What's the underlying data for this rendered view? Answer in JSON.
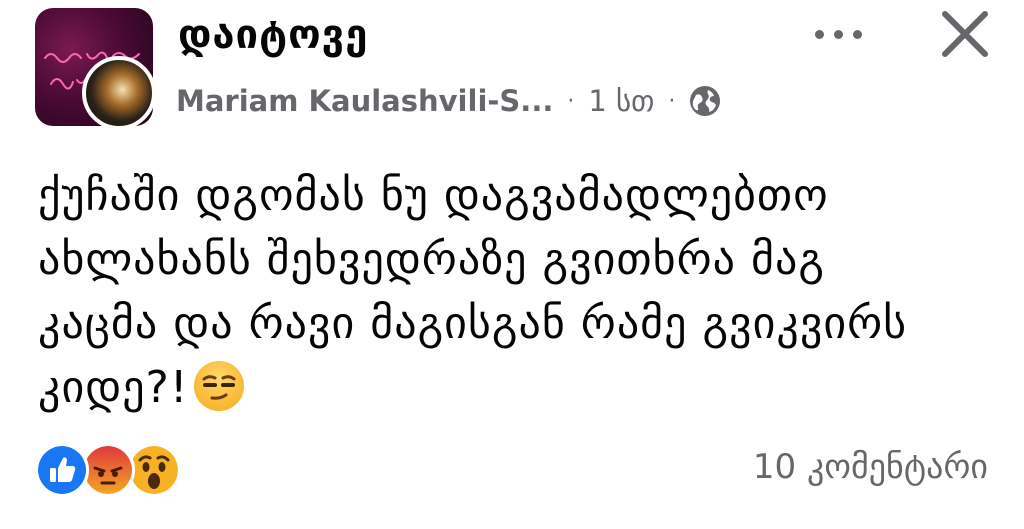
{
  "header": {
    "group_name": "დაიტოვე",
    "author": "Mariam Kaulashvili-S...",
    "separator": "·",
    "time": "1 სთ"
  },
  "post": {
    "text": "ქუჩაში დგომას ნუ დაგვამადლებთო\nახლახანს შეხვედრაზე გვითხრა მაგ\nკაცმა და რავი მაგისგან რამე გვიკვირს\nკიდე?!"
  },
  "footer": {
    "comments": "10 კომენტარი"
  },
  "icons": {
    "audience": "globe-icon",
    "more": "more-icon",
    "close": "close-icon",
    "reactions": [
      "like-icon",
      "angry-icon",
      "wow-icon"
    ],
    "emoji": "smirk-emoji"
  },
  "colors": {
    "text": "#050505",
    "secondary": "#65676b",
    "like": "#1877f2",
    "angry": "#e9710f",
    "wow": "#f7b125"
  }
}
